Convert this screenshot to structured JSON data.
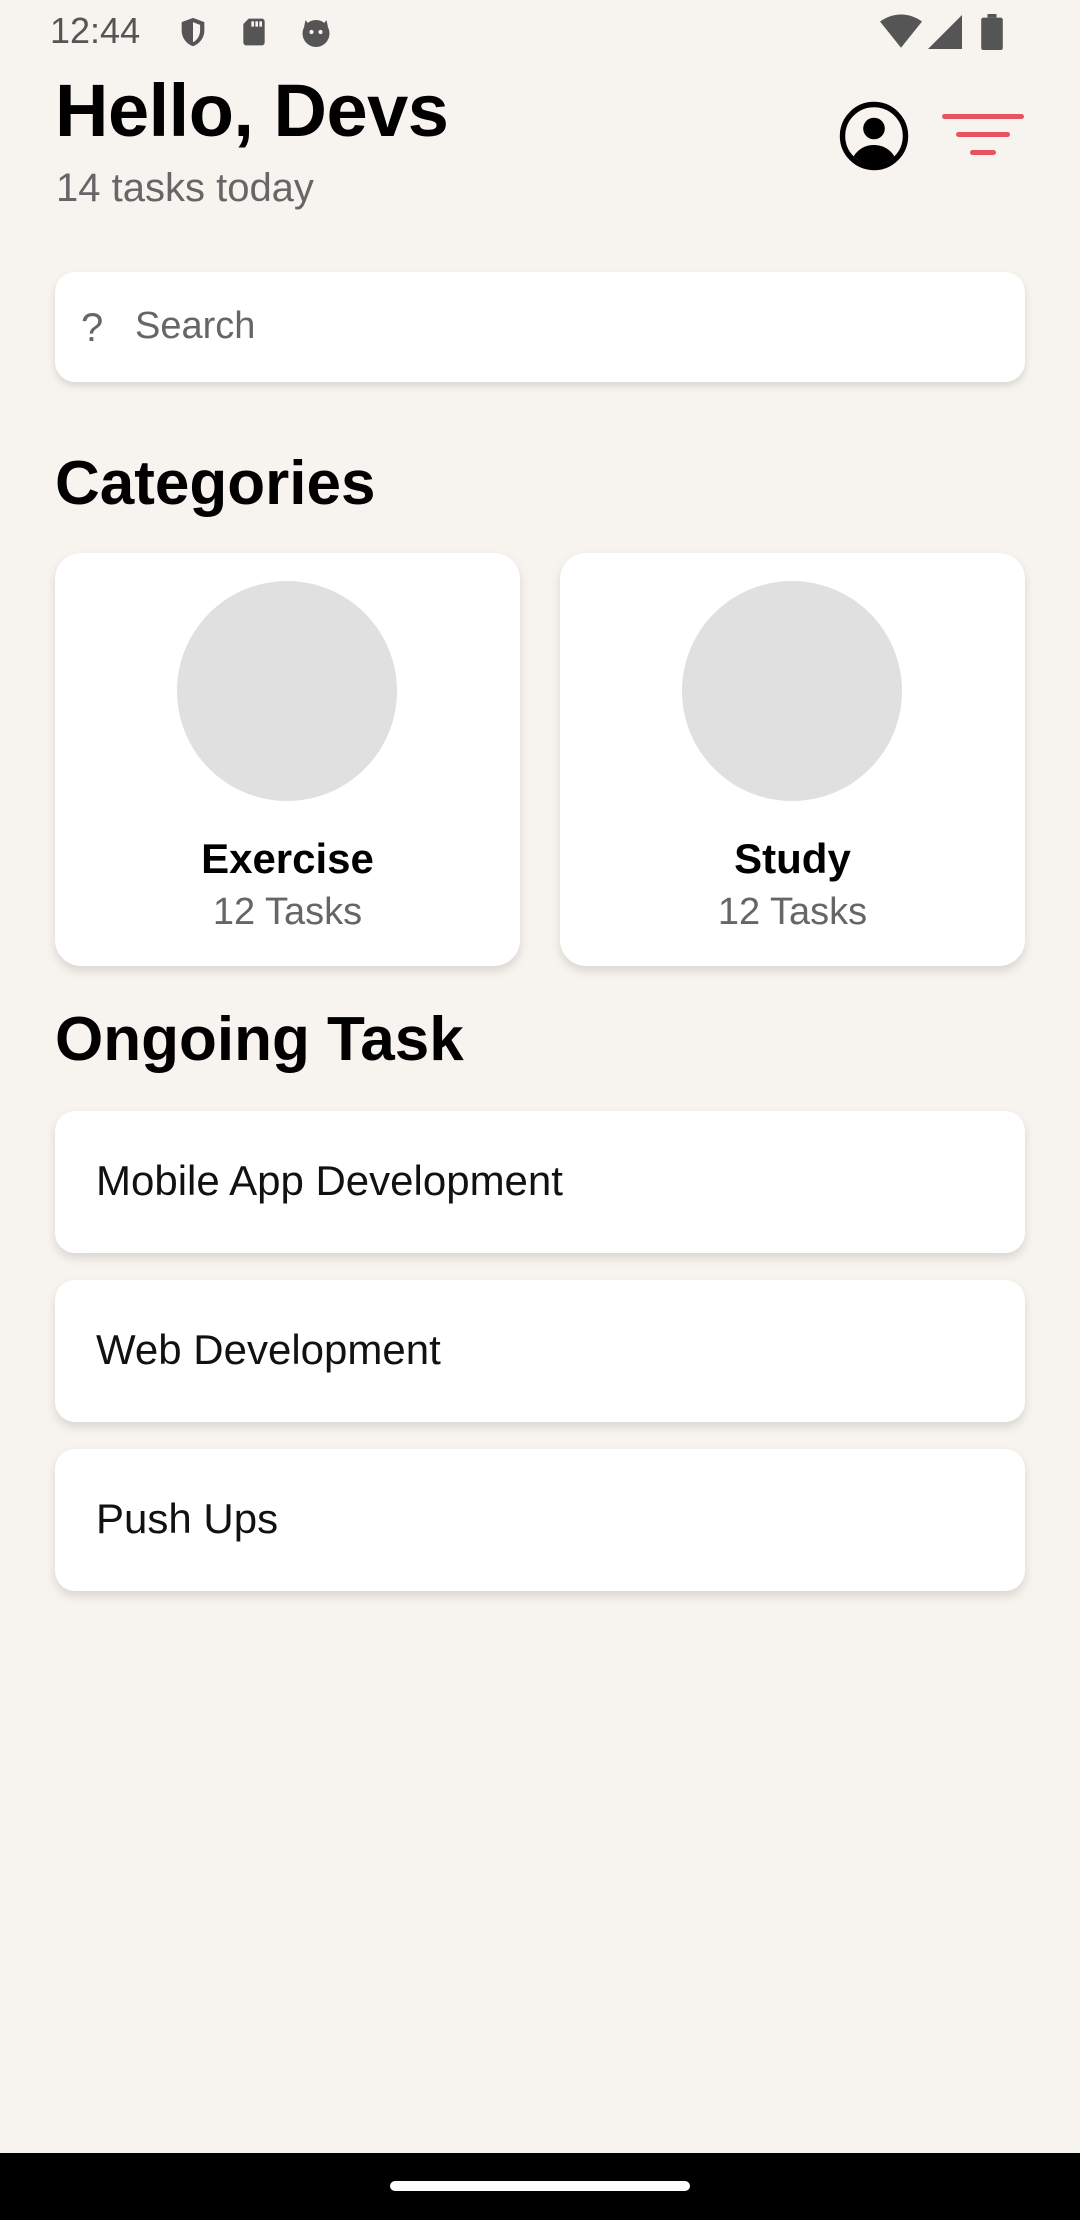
{
  "status_bar": {
    "time": "12:44",
    "icons": [
      "shield-icon",
      "sd-card-icon",
      "cat-icon",
      "wifi-icon",
      "signal-icon",
      "battery-icon"
    ]
  },
  "header": {
    "greeting": "Hello, Devs",
    "subtitle": "14 tasks today",
    "profile_icon": "account-circle-icon",
    "filter_icon": "filter-icon",
    "accent_color": "#E8545E"
  },
  "search": {
    "placeholder": "Search",
    "value": "",
    "icon": "?"
  },
  "categories": {
    "title": "Categories",
    "items": [
      {
        "name": "Exercise",
        "count": "12 Tasks"
      },
      {
        "name": "Study",
        "count": "12 Tasks"
      }
    ]
  },
  "ongoing": {
    "title": "Ongoing Task",
    "items": [
      {
        "label": "Mobile App Development"
      },
      {
        "label": "Web Development"
      },
      {
        "label": "Push Ups"
      }
    ]
  },
  "colors": {
    "background": "#F7F3EE",
    "card": "#FFFFFF",
    "placeholder_circle": "#E0E0E0"
  }
}
